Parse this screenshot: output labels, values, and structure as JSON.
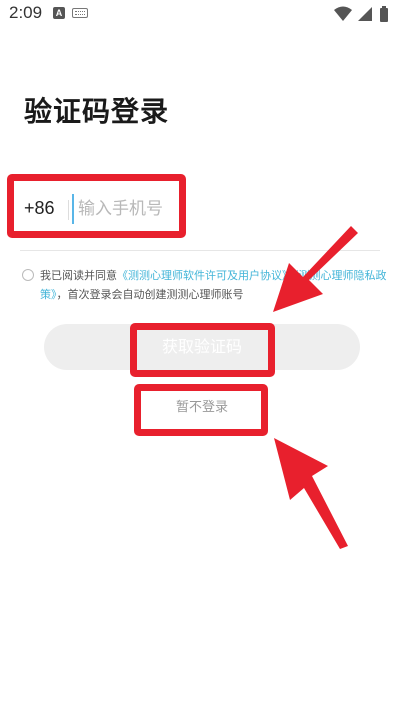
{
  "status_bar": {
    "time": "2:09",
    "app_icon_letter": "A"
  },
  "page": {
    "title": "验证码登录"
  },
  "phone": {
    "country_code": "+86",
    "placeholder": "输入手机号"
  },
  "agreement": {
    "prefix": "我已阅读并同意",
    "link_license": "《测测心理师软件许可及用户协议》",
    "and": "《测测心理师隐私政策》",
    "suffix": "，首次登录会自动创建测测心理师账号"
  },
  "actions": {
    "get_code_label": "获取验证码",
    "skip_label": "暂不登录"
  },
  "colors": {
    "annotation_red": "#e8202d",
    "link_blue": "#43b5d8",
    "button_disabled": "#eeeeee"
  }
}
